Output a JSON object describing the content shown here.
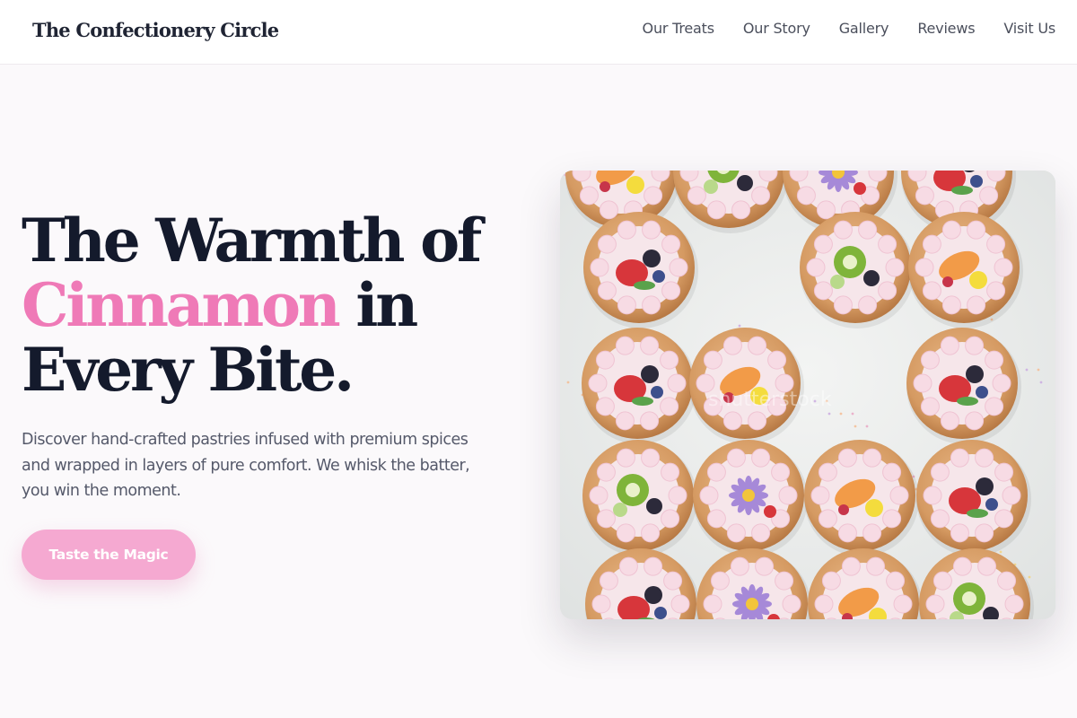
{
  "header": {
    "brand": "The Confectionery Circle",
    "nav": [
      "Our Treats",
      "Our Story",
      "Gallery",
      "Reviews",
      "Visit Us"
    ]
  },
  "hero": {
    "title_line1": "The Warmth of",
    "title_accent": "Cinnamon",
    "title_line2_rest": " in",
    "title_line3": "Every Bite.",
    "description": "Discover hand-crafted pastries infused with premium spices and wrapped in layers of pure comfort. We whisk the batter, you win the moment.",
    "cta_label": "Taste the Magic"
  },
  "image": {
    "subject": "fruit-topped-pastries-photo",
    "watermark": "shutterstock"
  },
  "colors": {
    "accent": "#ef7ab7",
    "button": "#f5a9d1",
    "heading": "#141a2c",
    "text": "#55596a",
    "background": "#fbf9fb"
  }
}
